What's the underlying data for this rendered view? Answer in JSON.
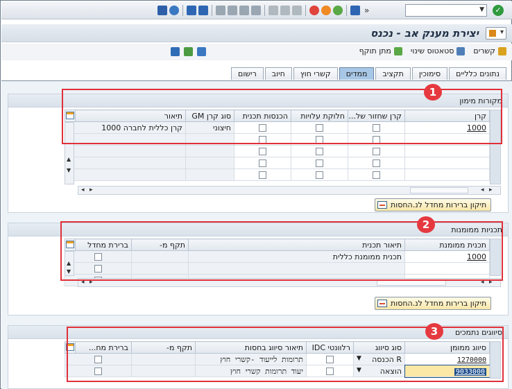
{
  "window": {
    "title": "יצירת מענק אב - נכנס",
    "command_field_value": ""
  },
  "toolbar": {
    "more_label": "»",
    "items": [
      {
        "label": "קשרים",
        "icon": "relations-icon"
      },
      {
        "label": "סטאטוס שינוי",
        "icon": "status-change-icon"
      },
      {
        "label": "מתן תוקף",
        "icon": "validate-icon"
      }
    ]
  },
  "tabs": [
    {
      "label": "נתונים כלליים",
      "active": false
    },
    {
      "label": "סימוכין",
      "active": false
    },
    {
      "label": "תקציב",
      "active": false
    },
    {
      "label": "ממדים",
      "active": true
    },
    {
      "label": "קשרי חוץ",
      "active": false
    },
    {
      "label": "חיוב",
      "active": false
    },
    {
      "label": "רישום",
      "active": false
    }
  ],
  "funding_sources": {
    "title": "מקורות מימון",
    "badge": "1",
    "columns": [
      "קרן",
      "קרן שחזור של...",
      "חלוקת עלויות",
      "הכנסות תכנית",
      "סוג קרן GM",
      "תיאור"
    ],
    "rows": [
      {
        "fund": "1000",
        "grant_type": "חיצוני",
        "description": "קרן כללית לחברה 1000"
      }
    ],
    "fix_button": "תיקון ברירות מחדל לנ.החסות"
  },
  "sponsored_programs": {
    "title": "תכניות ממומנות",
    "badge": "2",
    "columns": [
      "תכנית ממומנת",
      "תיאור תכנית",
      "תקף מ-",
      "ברירת מחדל"
    ],
    "rows": [
      {
        "program": "1000",
        "description": "תכנית ממומנת כללית"
      }
    ],
    "fix_button": "תיקון ברירות מחדל לנ.החסות"
  },
  "sponsored_classes": {
    "title": "סיווגים נתמכים",
    "badge": "3",
    "columns": [
      "סיווג ממומן",
      "סוג סיווג",
      "רלוונטי IDC",
      "תיאור סיווג בחסות",
      "תקף מ-",
      "ברירת מח..."
    ],
    "rows": [
      {
        "class": "1270000",
        "type": "R הכנסה",
        "description": "תרומות לייעוד -קשרי חוץ"
      },
      {
        "class": "9033000",
        "type": "הוצאה",
        "description": "יעוד תרומות קשרי חוץ"
      }
    ]
  }
}
